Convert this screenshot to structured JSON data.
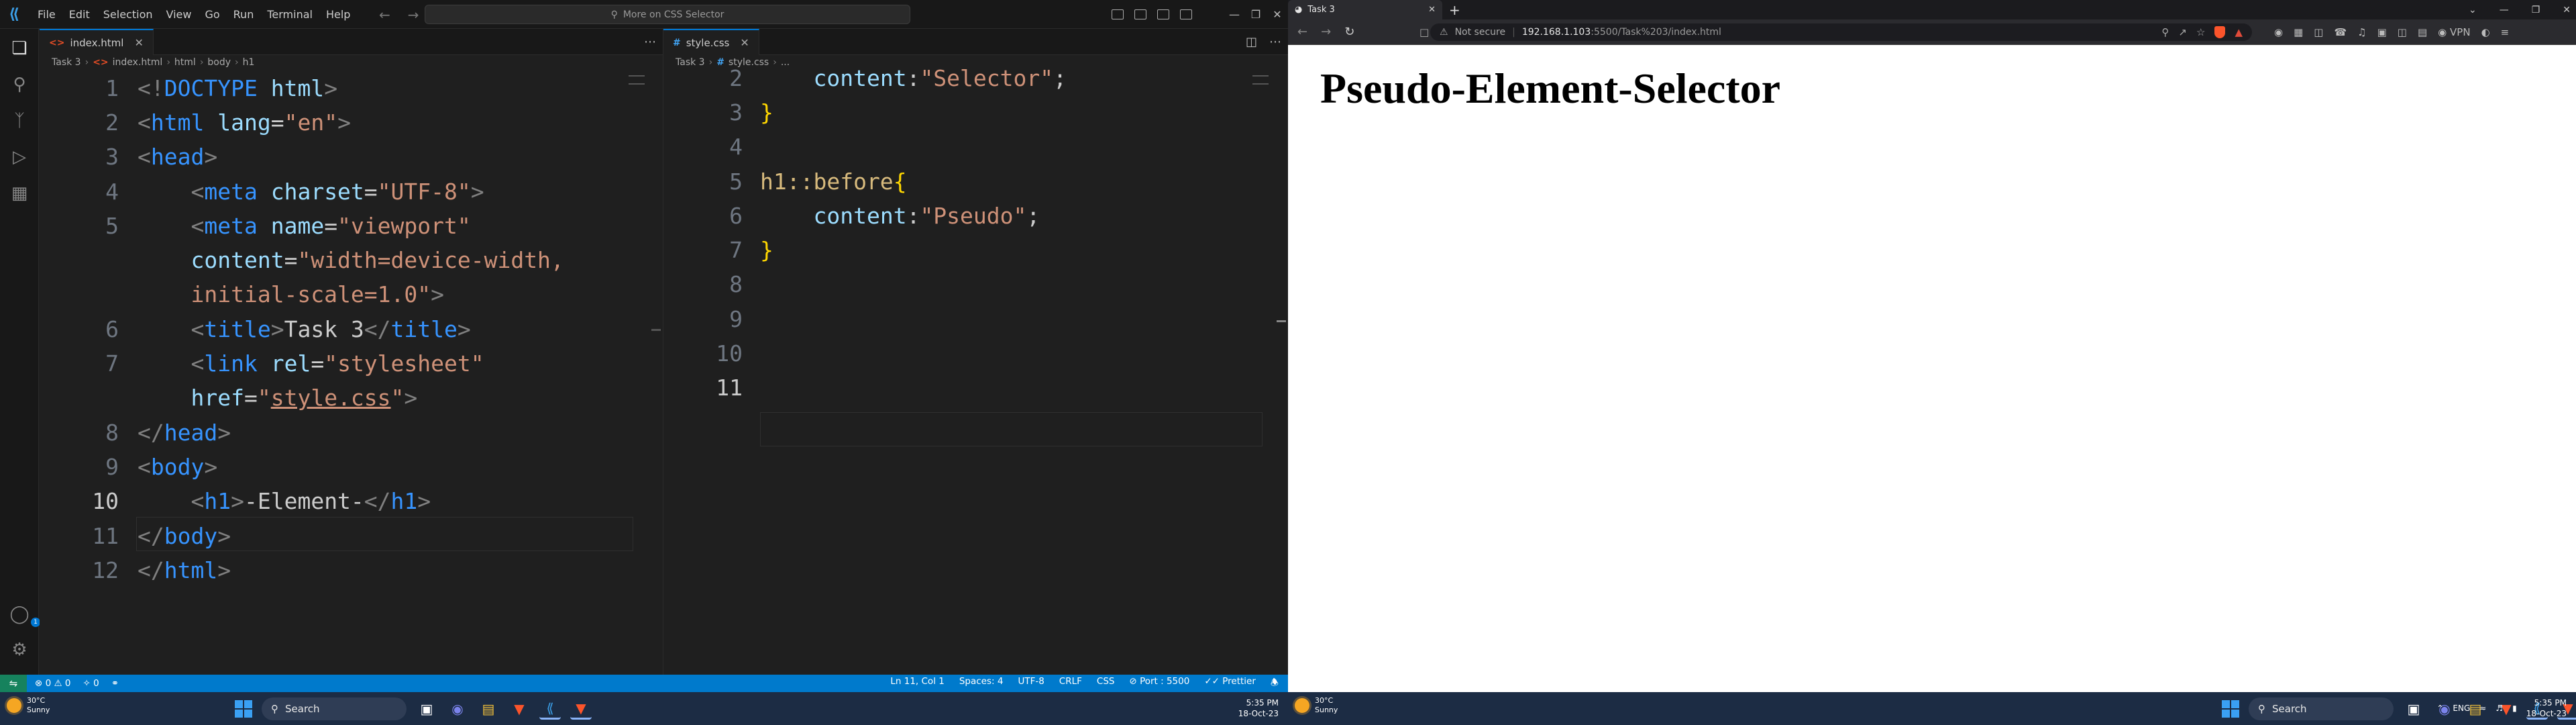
{
  "vscode": {
    "menu": [
      "File",
      "Edit",
      "Selection",
      "View",
      "Go",
      "Run",
      "Terminal",
      "Help"
    ],
    "command_center": "More on CSS Selector",
    "left": {
      "tab": "index.html",
      "breadcrumb": [
        "Task 3",
        "index.html",
        "html",
        "body",
        "h1"
      ],
      "lines": [
        {
          "n": "1"
        },
        {
          "n": "2"
        },
        {
          "n": "3"
        },
        {
          "n": "4"
        },
        {
          "n": "5"
        },
        {
          "n": ""
        },
        {
          "n": "6"
        },
        {
          "n": "7"
        },
        {
          "n": ""
        },
        {
          "n": "8"
        },
        {
          "n": "9"
        },
        {
          "n": "10"
        },
        {
          "n": "11"
        },
        {
          "n": "12"
        }
      ],
      "current_line": "10"
    },
    "right": {
      "tab": "style.css",
      "breadcrumb": [
        "Task 3",
        "style.css",
        "..."
      ],
      "lines": [
        "2",
        "3",
        "4",
        "5",
        "6",
        "7",
        "8",
        "9",
        "10",
        "11"
      ],
      "current_line": "11"
    },
    "status": {
      "errors": "0",
      "warnings": "0",
      "ports": "0",
      "position": "Ln 11, Col 1",
      "spaces": "Spaces: 4",
      "encoding": "UTF-8",
      "eol": "CRLF",
      "language": "CSS",
      "port": "Port : 5500",
      "prettier": "Prettier"
    }
  },
  "browser": {
    "tab_title": "Task 3",
    "not_secure": "Not secure",
    "url_host": "192.168.1.103",
    "url_path": ":5500/Task%203/index.html",
    "vpn": "VPN",
    "h1_before": "Pseudo",
    "h1_text": "-Element-",
    "h1_after": "Selector"
  },
  "taskbar": {
    "temp": "30°C",
    "condition": "Sunny",
    "search": "Search",
    "time": "5:35 PM",
    "date": "18-Oct-23",
    "lang": "ENG"
  },
  "colors": {
    "status_bar": "#007acc",
    "tag": "#3794ff",
    "string": "#ce9178",
    "selector": "#d7ba7d"
  }
}
